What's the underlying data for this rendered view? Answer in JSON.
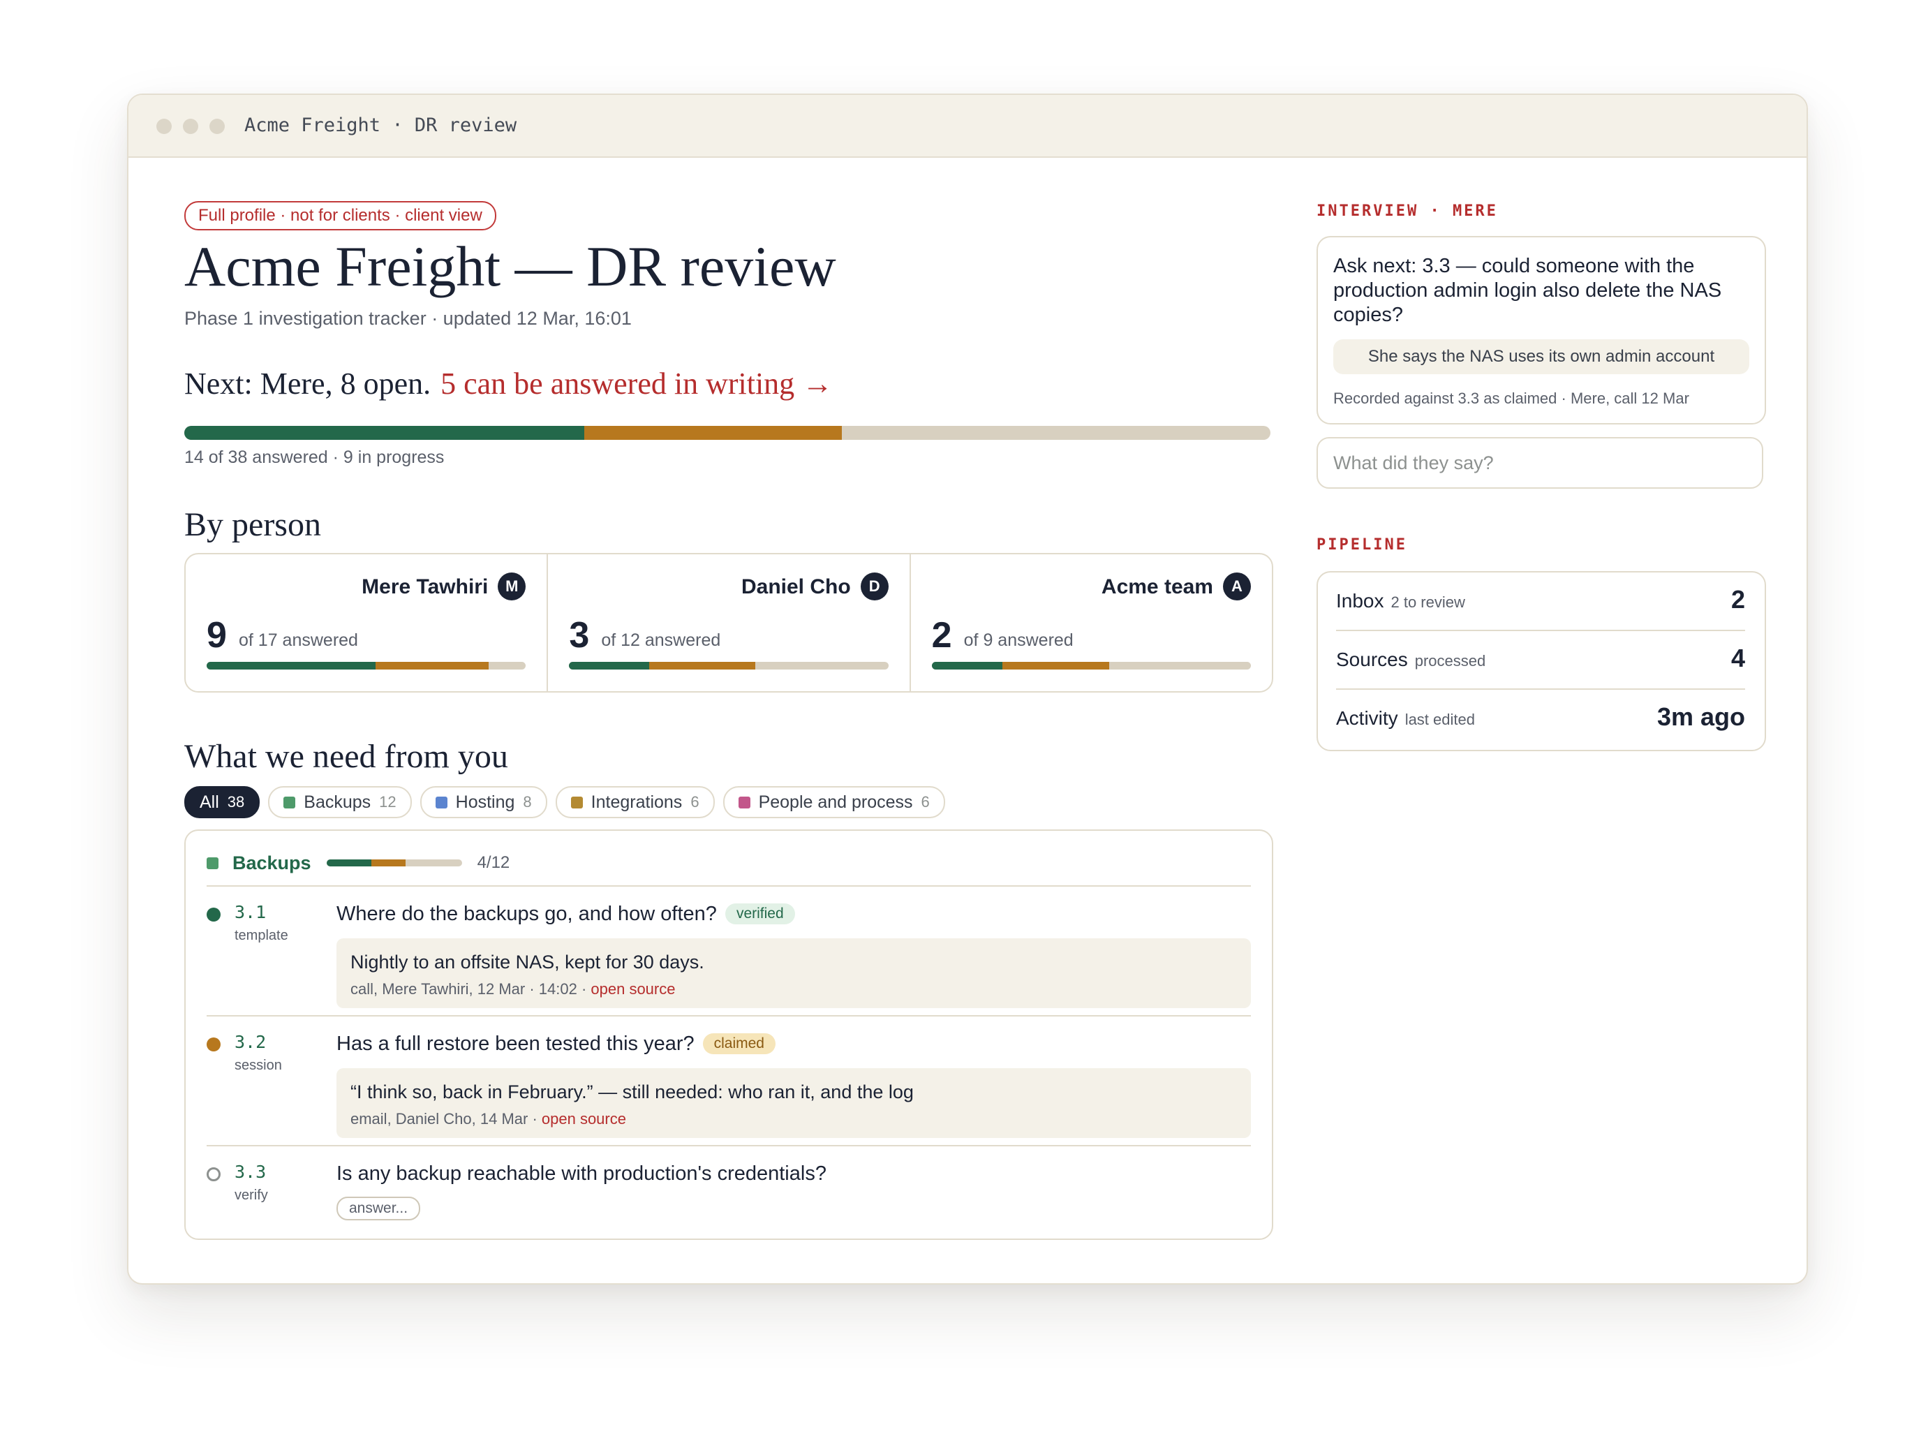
{
  "window": {
    "title": "Acme Freight · DR review"
  },
  "header": {
    "visibility_note": "Full profile · not for clients · client view",
    "title": "Acme Freight — DR review",
    "subtitle": "Phase 1 investigation tracker · updated 12 Mar, 16:01",
    "next_prefix": "Next: Mere, 8 open.",
    "next_link": "5 can be answered in writing →",
    "progress": {
      "answered": 14,
      "in_progress": 9,
      "total": 38,
      "label": "14 of 38 answered · 9 in progress"
    }
  },
  "by_person": {
    "heading": "By person",
    "people": [
      {
        "name": "Mere Tawhiri",
        "initial": "M",
        "count": "9",
        "of_label": "of 17 answered",
        "answered": 9,
        "in_progress": 6,
        "total": 17
      },
      {
        "name": "Daniel Cho",
        "initial": "D",
        "count": "3",
        "of_label": "of 12 answered",
        "answered": 3,
        "in_progress": 4,
        "total": 12
      },
      {
        "name": "Acme team",
        "initial": "A",
        "count": "2",
        "of_label": "of 9 answered",
        "answered": 2,
        "in_progress": 3,
        "total": 9
      }
    ]
  },
  "needs": {
    "heading": "What we need from you",
    "filters": [
      {
        "label": "All",
        "count": "38",
        "active": true,
        "color": ""
      },
      {
        "label": "Backups",
        "count": "12",
        "active": false,
        "color": "#4e9a6a"
      },
      {
        "label": "Hosting",
        "count": "8",
        "active": false,
        "color": "#5b84cf"
      },
      {
        "label": "Integrations",
        "count": "6",
        "active": false,
        "color": "#b48a32"
      },
      {
        "label": "People and process",
        "count": "6",
        "active": false,
        "color": "#c2568a"
      }
    ],
    "group": {
      "label": "Backups",
      "color": "#4e9a6a",
      "progress_label": "4/12",
      "answered": 4,
      "in_progress": 3,
      "total": 12
    },
    "questions": [
      {
        "id": "3.1",
        "stage": "template",
        "status": "verified",
        "question": "Where do the backups go, and how often?",
        "badge": "verified",
        "answer": "Nightly to an offsite NAS, kept for 30 days.",
        "meta": "call, Mere Tawhiri, 12 Mar · 14:02 · ",
        "source_link": "open source"
      },
      {
        "id": "3.2",
        "stage": "session",
        "status": "claimed",
        "question": "Has a full restore been tested this year?",
        "badge": "claimed",
        "answer": "“I think so, back in February.” — still needed: who ran it, and the log",
        "meta": "email, Daniel Cho, 14 Mar · ",
        "source_link": "open source"
      },
      {
        "id": "3.3",
        "stage": "verify",
        "status": "open",
        "question": "Is any backup reachable with production's credentials?",
        "answer_button": "answer..."
      }
    ]
  },
  "interview": {
    "label": "INTERVIEW · MERE",
    "ask_next": "Ask next: 3.3 — could someone with the production admin login also delete the NAS copies?",
    "suggestion": "She says the NAS uses its own admin account",
    "recorded": "Recorded against 3.3 as claimed · Mere, call 12 Mar",
    "input_placeholder": "What did they say?"
  },
  "pipeline": {
    "label": "PIPELINE",
    "rows": [
      {
        "label": "Inbox",
        "sub": "2 to review",
        "value": "2"
      },
      {
        "label": "Sources",
        "sub": "processed",
        "value": "4"
      },
      {
        "label": "Activity",
        "sub": "last edited",
        "value": "3m ago"
      }
    ]
  },
  "colors": {
    "answered": "#23684a",
    "in_progress": "#b7781e",
    "remaining": "#d8d0c0",
    "accent_red": "#b52d2d",
    "ink": "#1b2233"
  }
}
